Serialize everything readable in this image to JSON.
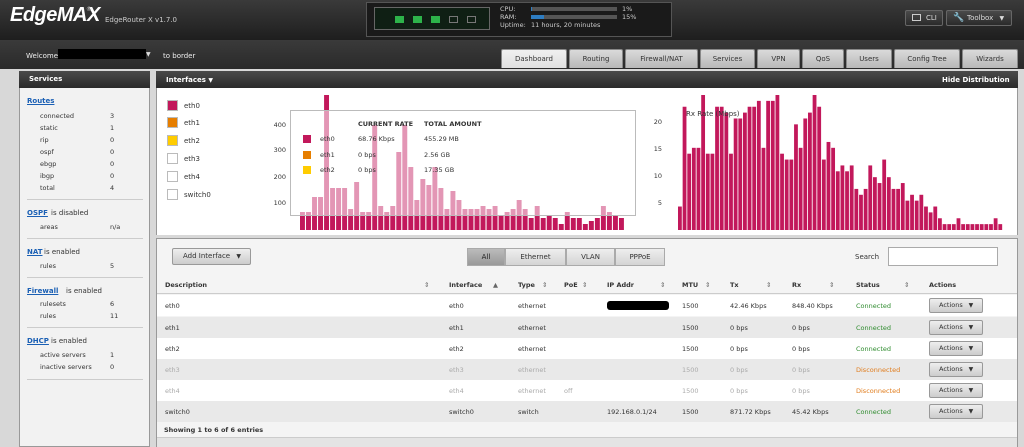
{
  "header": {
    "logo": "EdgeMAX",
    "reg_mark": "®",
    "router_model": "EdgeRouter X v1.7.0",
    "ports": [
      {
        "name": "eth0",
        "state": "up"
      },
      {
        "name": "eth1",
        "state": "up"
      },
      {
        "name": "eth2",
        "state": "up"
      },
      {
        "name": "eth3",
        "state": "down"
      },
      {
        "name": "eth4",
        "state": "down"
      }
    ],
    "cpu_label": "CPU:",
    "cpu_value": "1%",
    "cpu_fraction": 0.01,
    "ram_label": "RAM:",
    "ram_value": "15%",
    "ram_fraction": 0.15,
    "uptime_label": "Uptime:",
    "uptime_value": "11 hours, 20 minutes",
    "cli_label": "CLI",
    "toolbox_label": "Toolbox"
  },
  "userbar": {
    "welcome": "Welcome",
    "to_label": "to border"
  },
  "nav_tabs": [
    "Dashboard",
    "Routing",
    "Firewall/NAT",
    "Services",
    "VPN",
    "QoS",
    "Users",
    "Config Tree",
    "Wizards"
  ],
  "sidebar": {
    "title": "Services",
    "routes": {
      "link": "Routes",
      "rows": [
        {
          "label": "connected",
          "value": "3"
        },
        {
          "label": "static",
          "value": "1"
        },
        {
          "label": "rip",
          "value": "0"
        },
        {
          "label": "ospf",
          "value": "0"
        },
        {
          "label": "ebgp",
          "value": "0"
        },
        {
          "label": "ibgp",
          "value": "0"
        },
        {
          "label": "total",
          "value": "4"
        }
      ]
    },
    "ospf": {
      "link": "OSPF",
      "tail": "is disabled",
      "rows": [
        {
          "label": "areas",
          "value": "n/a"
        }
      ]
    },
    "nat": {
      "link": "NAT",
      "tail": "is enabled",
      "rows": [
        {
          "label": "rules",
          "value": "5"
        }
      ]
    },
    "firewall": {
      "link": "Firewall",
      "tail": "is enabled",
      "rows": [
        {
          "label": "rulesets",
          "value": "6"
        },
        {
          "label": "rules",
          "value": "11"
        }
      ]
    },
    "dhcp": {
      "link": "DHCP",
      "tail": "is enabled",
      "rows": [
        {
          "label": "active servers",
          "value": "1"
        },
        {
          "label": "inactive servers",
          "value": "0"
        }
      ]
    }
  },
  "interfaces_panel": {
    "title": "Interfaces",
    "hide_label": "Hide Distribution",
    "legend": [
      {
        "name": "eth0",
        "color": "#c2185b"
      },
      {
        "name": "eth1",
        "color": "#e67e00"
      },
      {
        "name": "eth2",
        "color": "#ffcc00"
      },
      {
        "name": "eth3",
        "color": "#ffffff"
      },
      {
        "name": "eth4",
        "color": "#ffffff"
      },
      {
        "name": "switch0",
        "color": "#ffffff"
      }
    ],
    "tooltip": {
      "col_rate": "CURRENT RATE",
      "col_total": "TOTAL AMOUNT",
      "rows": [
        {
          "name": "eth0",
          "rate": "68.76 Kbps",
          "total": "455.29 MB",
          "color": "#c2185b"
        },
        {
          "name": "eth1",
          "rate": "0 bps",
          "total": "2.56 GB",
          "color": "#e67e00"
        },
        {
          "name": "eth2",
          "rate": "0 bps",
          "total": "17.35 GB",
          "color": "#ffcc00"
        }
      ]
    }
  },
  "chart_data": [
    {
      "type": "bar",
      "title": "",
      "ylabel": "",
      "ylim": [
        0,
        450
      ],
      "yticks": [
        "400",
        "300",
        "200",
        "100"
      ],
      "values": [
        60,
        60,
        110,
        110,
        450,
        140,
        140,
        140,
        70,
        160,
        60,
        60,
        350,
        80,
        60,
        80,
        260,
        350,
        210,
        100,
        170,
        150,
        210,
        140,
        70,
        130,
        100,
        70,
        70,
        70,
        80,
        70,
        80,
        50,
        60,
        70,
        100,
        70,
        40,
        80,
        40,
        50,
        40,
        20,
        60,
        40,
        40,
        20,
        30,
        40,
        80,
        60,
        50,
        40
      ]
    },
    {
      "type": "bar",
      "title": "",
      "ylabel": "Rx Rate (Mbps)",
      "ylim": [
        0,
        23
      ],
      "yticks": [
        "20",
        "15",
        "10",
        "5"
      ],
      "values": [
        4,
        21,
        13,
        14,
        14,
        23,
        13,
        13,
        21,
        21,
        20,
        13,
        19,
        19,
        20,
        21,
        21,
        22,
        14,
        22,
        22,
        23,
        13,
        12,
        12,
        18,
        14,
        19,
        20,
        23,
        21,
        12,
        15,
        14,
        10,
        11,
        10,
        11,
        7,
        6,
        7,
        11,
        9,
        8,
        12,
        9,
        7,
        7,
        8,
        5,
        6,
        5,
        6,
        4,
        3,
        4,
        2,
        1,
        1,
        1,
        2,
        1,
        1,
        1,
        1,
        1,
        1,
        1,
        2,
        1
      ]
    }
  ],
  "table": {
    "add_label": "Add Interface",
    "filters": [
      "All",
      "Ethernet",
      "VLAN",
      "PPPoE"
    ],
    "search_label": "Search",
    "headers": [
      "Description",
      "Interface",
      "Type",
      "PoE",
      "IP Addr",
      "MTU",
      "Tx",
      "Rx",
      "Status",
      "Actions"
    ],
    "rows": [
      {
        "desc": "eth0",
        "iface": "eth0",
        "type": "ethernet",
        "poe": "",
        "ip": "",
        "mtu": "1500",
        "tx": "42.46 Kbps",
        "rx": "848.40 Kbps",
        "status": "Connected",
        "action": "Actions"
      },
      {
        "desc": "eth1",
        "iface": "eth1",
        "type": "ethernet",
        "poe": "",
        "ip": "",
        "mtu": "1500",
        "tx": "0 bps",
        "rx": "0 bps",
        "status": "Connected",
        "action": "Actions"
      },
      {
        "desc": "eth2",
        "iface": "eth2",
        "type": "ethernet",
        "poe": "",
        "ip": "",
        "mtu": "1500",
        "tx": "0 bps",
        "rx": "0 bps",
        "status": "Connected",
        "action": "Actions"
      },
      {
        "desc": "eth3",
        "iface": "eth3",
        "type": "ethernet",
        "poe": "",
        "ip": "",
        "mtu": "1500",
        "tx": "0 bps",
        "rx": "0 bps",
        "status": "Disconnected",
        "action": "Actions"
      },
      {
        "desc": "eth4",
        "iface": "eth4",
        "type": "ethernet",
        "poe": "off",
        "ip": "",
        "mtu": "1500",
        "tx": "0 bps",
        "rx": "0 bps",
        "status": "Disconnected",
        "action": "Actions"
      },
      {
        "desc": "switch0",
        "iface": "switch0",
        "type": "switch",
        "poe": "",
        "ip": "192.168.0.1/24",
        "mtu": "1500",
        "tx": "871.72 Kbps",
        "rx": "45.42 Kbps",
        "status": "Connected",
        "action": "Actions"
      }
    ],
    "showing": "Showing 1 to 6 of 6 entries"
  }
}
